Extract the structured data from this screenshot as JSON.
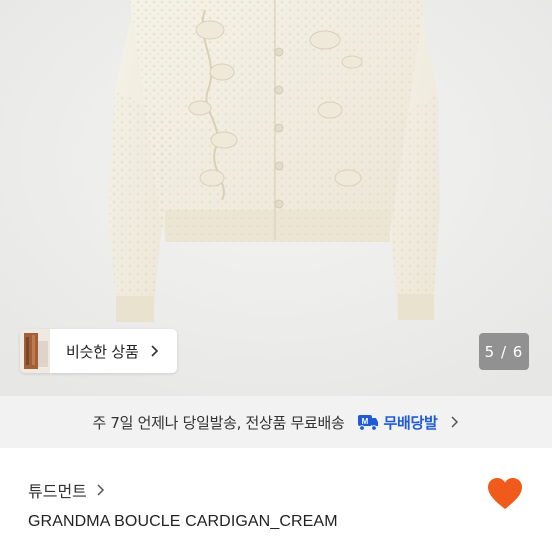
{
  "gallery": {
    "similar_label": "비슷한 상품",
    "page_indicator": "5 / 6"
  },
  "delivery_banner": {
    "text": "주 7일 언제나 당일발송, 전상품 무료배송",
    "badge_label": "무배당발",
    "badge_color": "#1f5bd9"
  },
  "product": {
    "shop_name": "튜드먼트",
    "title": "GRANDMA BOUCLE CARDIGAN_CREAM",
    "like_icon": "heart-icon",
    "like_color": "#f05a1a"
  }
}
